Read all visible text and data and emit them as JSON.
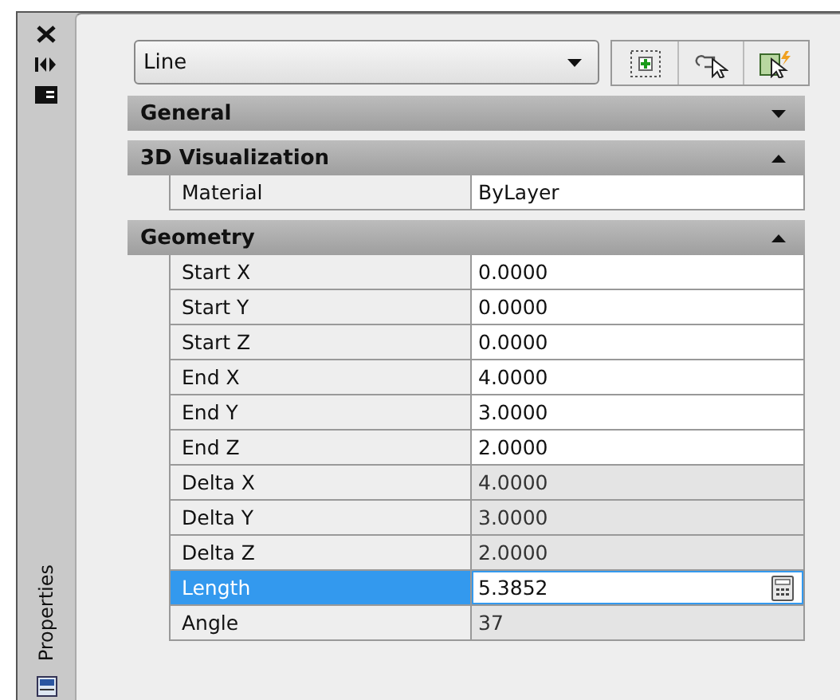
{
  "side_tab": {
    "label": "Properties"
  },
  "object_select": {
    "value": "Line"
  },
  "sections": [
    {
      "title": "General",
      "expanded": false
    },
    {
      "title": "3D Visualization",
      "expanded": true,
      "rows": [
        {
          "name": "Material",
          "value": "ByLayer",
          "readonly": false,
          "selected": false,
          "kind": "text"
        }
      ]
    },
    {
      "title": "Geometry",
      "expanded": true,
      "rows": [
        {
          "name": "Start X",
          "value": "0.0000",
          "readonly": false,
          "selected": false,
          "kind": "text"
        },
        {
          "name": "Start Y",
          "value": "0.0000",
          "readonly": false,
          "selected": false,
          "kind": "text"
        },
        {
          "name": "Start Z",
          "value": "0.0000",
          "readonly": false,
          "selected": false,
          "kind": "text"
        },
        {
          "name": "End X",
          "value": "4.0000",
          "readonly": false,
          "selected": false,
          "kind": "text"
        },
        {
          "name": "End Y",
          "value": "3.0000",
          "readonly": false,
          "selected": false,
          "kind": "text"
        },
        {
          "name": "End Z",
          "value": "2.0000",
          "readonly": false,
          "selected": false,
          "kind": "text"
        },
        {
          "name": "Delta X",
          "value": "4.0000",
          "readonly": true,
          "selected": false,
          "kind": "text"
        },
        {
          "name": "Delta Y",
          "value": "3.0000",
          "readonly": true,
          "selected": false,
          "kind": "text"
        },
        {
          "name": "Delta Z",
          "value": "2.0000",
          "readonly": true,
          "selected": false,
          "kind": "text"
        },
        {
          "name": "Length",
          "value": "5.3852",
          "readonly": false,
          "selected": true,
          "kind": "calc"
        },
        {
          "name": "Angle",
          "value": "37",
          "readonly": true,
          "selected": false,
          "kind": "text"
        }
      ]
    }
  ]
}
